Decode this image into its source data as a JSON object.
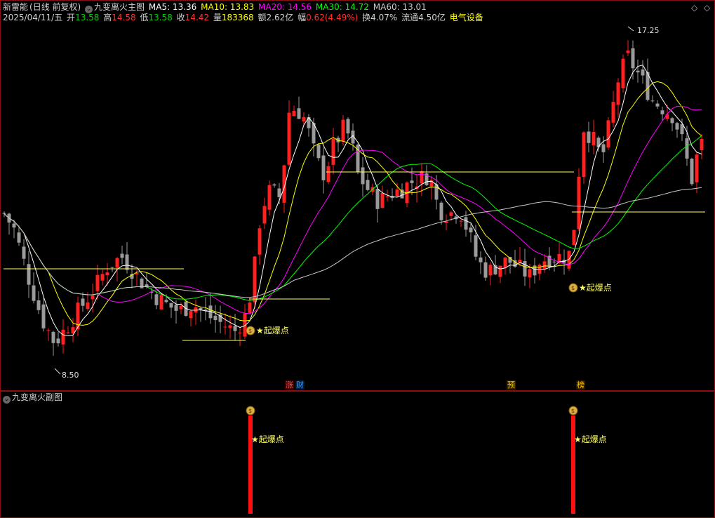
{
  "header": {
    "stock_name": "新雷能",
    "period": "(日线 前复权)",
    "indicator": "九变离火主图",
    "ma": [
      {
        "label": "MA5: 13.36",
        "color": "#ffffff"
      },
      {
        "label": "MA10: 13.83",
        "color": "#ffff00"
      },
      {
        "label": "MA20: 14.56",
        "color": "#ff00ff"
      },
      {
        "label": "MA30: 14.72",
        "color": "#00ff00"
      },
      {
        "label": "MA60: 13.01",
        "color": "#c8c8c8"
      }
    ],
    "date": "2025/04/11/五",
    "open_label": "开",
    "open": "13.58",
    "high_label": "高",
    "high": "14.58",
    "low_label": "低",
    "low": "13.58",
    "close_label": "收",
    "close": "14.42",
    "vol_label": "量",
    "vol": "183368",
    "amt_label": "额",
    "amt": "2.62亿",
    "chg_label": "幅",
    "chg": "0.62(4.49%)",
    "turnover_label": "换",
    "turnover": "4.07%",
    "float_label": "流通",
    "float": "4.50亿",
    "sector": "电气设备"
  },
  "window_controls": {
    "icon1": "◇",
    "icon2": "◇"
  },
  "sub_chart": {
    "title": "九变离火副图"
  },
  "markers": {
    "explosion": "起爆点",
    "low": "8.50",
    "high": "17.25"
  },
  "tags": [
    {
      "text": "涨",
      "color": "#ff5050",
      "bg": "#3a0000"
    },
    {
      "text": "财",
      "color": "#40a0ff",
      "bg": "#001a3a"
    },
    {
      "text": "预",
      "color": "#ffcc00",
      "bg": "#2a2000"
    },
    {
      "text": "榜",
      "color": "#ffcc00",
      "bg": "#2a1500"
    }
  ],
  "colors": {
    "up": "#ff2020",
    "down": "#9a9a9a",
    "ma5": "#ffffff",
    "ma10": "#ffff00",
    "ma20": "#ff00ff",
    "ma30": "#00ff00",
    "ma60": "#c8c8c8",
    "level": "#ffff66",
    "border": "#8a1010"
  },
  "chart_data": {
    "type": "candlestick",
    "price_axis_visible_extremes": {
      "low": 8.5,
      "high": 17.25
    },
    "series": [
      {
        "name": "MA5",
        "last": 13.36
      },
      {
        "name": "MA10",
        "last": 13.83
      },
      {
        "name": "MA20",
        "last": 14.56
      },
      {
        "name": "MA30",
        "last": 14.72
      },
      {
        "name": "MA60",
        "last": 13.01
      }
    ],
    "signals": [
      "起爆点",
      "起爆点"
    ],
    "last_bar": {
      "date": "2025/04/11",
      "open": 13.58,
      "high": 14.58,
      "low": 13.58,
      "close": 14.42,
      "volume": 183368,
      "amount": "2.62亿",
      "change": 0.62,
      "change_pct": 4.49,
      "turnover_pct": 4.07
    }
  }
}
